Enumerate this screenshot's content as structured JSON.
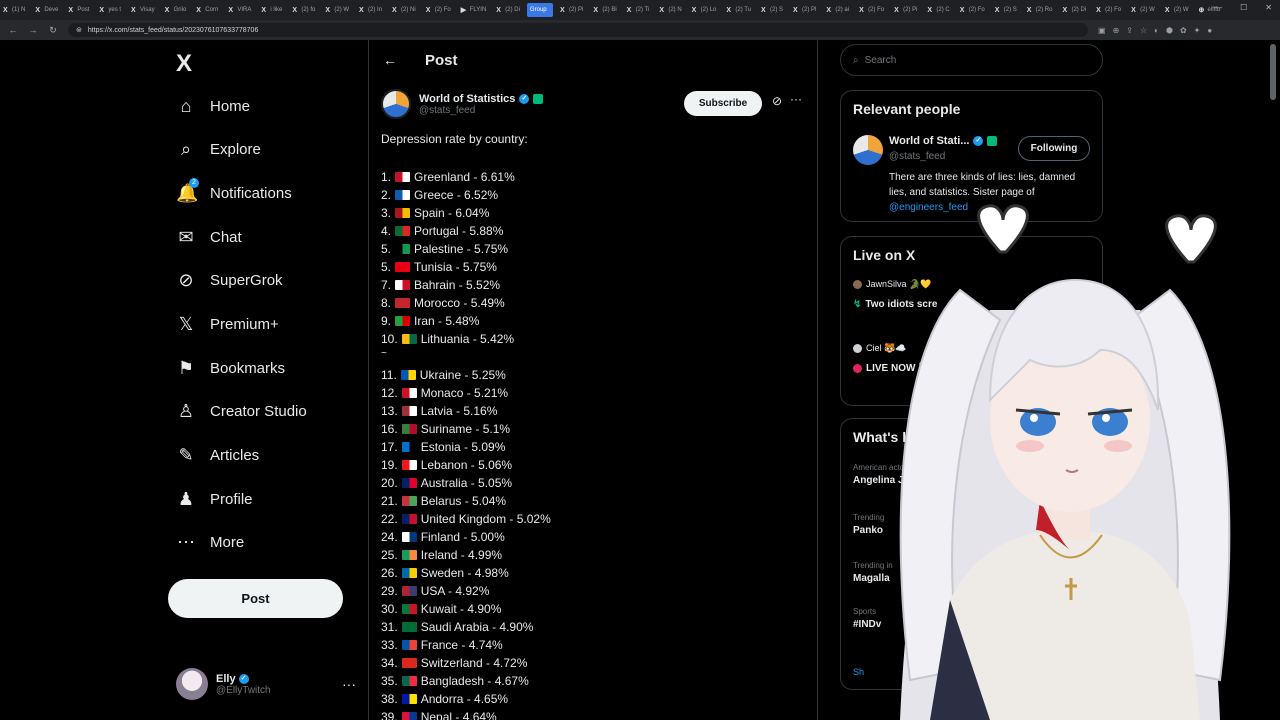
{
  "browser": {
    "tabs": [
      {
        "icon": "X",
        "label": "(1) N"
      },
      {
        "icon": "X",
        "label": "Deve"
      },
      {
        "icon": "X",
        "label": "Post"
      },
      {
        "icon": "X",
        "label": "yes t"
      },
      {
        "icon": "X",
        "label": "Visay"
      },
      {
        "icon": "X",
        "label": "Grilo"
      },
      {
        "icon": "X",
        "label": "Corn"
      },
      {
        "icon": "X",
        "label": "VIRA"
      },
      {
        "icon": "X",
        "label": "i like"
      },
      {
        "icon": "X",
        "label": "(2) fo"
      },
      {
        "icon": "X",
        "label": "(2) W"
      },
      {
        "icon": "X",
        "label": "(2) In"
      },
      {
        "icon": "X",
        "label": "(2) Ni"
      },
      {
        "icon": "X",
        "label": "(2) Fo"
      },
      {
        "icon": "▶",
        "label": "FLYIN"
      },
      {
        "icon": "X",
        "label": "(2) Di"
      },
      {
        "icon": "",
        "label": "Group",
        "active": true
      },
      {
        "icon": "X",
        "label": "(2) Pi"
      },
      {
        "icon": "X",
        "label": "(2) Bi"
      },
      {
        "icon": "X",
        "label": "(2) Ti"
      },
      {
        "icon": "X",
        "label": "(2) N"
      },
      {
        "icon": "X",
        "label": "(2) Lo"
      },
      {
        "icon": "X",
        "label": "(2) Tu"
      },
      {
        "icon": "X",
        "label": "(2) S"
      },
      {
        "icon": "X",
        "label": "(2) Pl"
      },
      {
        "icon": "X",
        "label": "(2) ai"
      },
      {
        "icon": "X",
        "label": "(2) Fo"
      },
      {
        "icon": "X",
        "label": "(2) Pi"
      },
      {
        "icon": "X",
        "label": "(2) C"
      },
      {
        "icon": "X",
        "label": "(2) Fo"
      },
      {
        "icon": "X",
        "label": "(2) S"
      },
      {
        "icon": "X",
        "label": "(2) Ro"
      },
      {
        "icon": "X",
        "label": "(2) Di"
      },
      {
        "icon": "X",
        "label": "(2) Fo"
      },
      {
        "icon": "X",
        "label": "(2) W"
      },
      {
        "icon": "X",
        "label": "(2) W"
      },
      {
        "icon": "⊕",
        "label": "elfffb"
      }
    ],
    "url": "https://x.com/stats_feed/status/2023076107633778706",
    "window_controls": [
      "—",
      "☐",
      "✕"
    ]
  },
  "leftnav": {
    "logo": "X",
    "items": [
      {
        "label": "Home",
        "icon": "home-icon",
        "glyph": "⌂"
      },
      {
        "label": "Explore",
        "icon": "search-icon",
        "glyph": "⌕"
      },
      {
        "label": "Notifications",
        "icon": "bell-icon",
        "glyph": "🔔",
        "badge": "2"
      },
      {
        "label": "Chat",
        "icon": "mail-icon",
        "glyph": "✉"
      },
      {
        "label": "SuperGrok",
        "icon": "grok-icon",
        "glyph": "⊘"
      },
      {
        "label": "Premium+",
        "icon": "x-premium-icon",
        "glyph": "𝕏"
      },
      {
        "label": "Bookmarks",
        "icon": "bookmark-icon",
        "glyph": "⚑"
      },
      {
        "label": "Creator Studio",
        "icon": "creator-studio-icon",
        "glyph": "♙"
      },
      {
        "label": "Articles",
        "icon": "articles-icon",
        "glyph": "✎"
      },
      {
        "label": "Profile",
        "icon": "profile-icon",
        "glyph": "♟"
      },
      {
        "label": "More",
        "icon": "more-circle-icon",
        "glyph": "⋯"
      }
    ],
    "post_button": "Post",
    "account": {
      "name": "Elly",
      "handle": "@EllyTwitch",
      "more": "···"
    }
  },
  "post": {
    "header_title": "Post",
    "author": {
      "name": "World of Statistics",
      "handle": "@stats_feed"
    },
    "subscribe_label": "Subscribe",
    "intro": "Depression rate by country:",
    "rows_top": [
      {
        "text": "1. ",
        "flag": [
          "#c8102e",
          "#ffffff"
        ],
        "label": "Greenland - 6.61%"
      },
      {
        "text": "2. ",
        "flag": [
          "#0d5eaf",
          "#ffffff"
        ],
        "label": "Greece - 6.52%"
      },
      {
        "text": "3. ",
        "flag": [
          "#aa151b",
          "#f1bf00"
        ],
        "label": "Spain - 6.04%"
      },
      {
        "text": "4. ",
        "flag": [
          "#046a38",
          "#da291c"
        ],
        "label": "Portugal - 5.88%"
      },
      {
        "text": "5. ",
        "flag": [
          "#000000",
          "#149954"
        ],
        "label": "Palestine - 5.75%"
      },
      {
        "text": "5. ",
        "flag": [
          "#e70013",
          "#e70013"
        ],
        "label": "Tunisia - 5.75%"
      },
      {
        "text": "7. ",
        "flag": [
          "#ffffff",
          "#ce1126"
        ],
        "label": "Bahrain - 5.52%"
      },
      {
        "text": "8. ",
        "flag": [
          "#c1272d",
          "#c1272d"
        ],
        "label": "Morocco - 5.49%"
      },
      {
        "text": "9. ",
        "flag": [
          "#239f40",
          "#da0000"
        ],
        "label": "Iran - 5.48%"
      },
      {
        "text": "10. ",
        "flag": [
          "#fdb913",
          "#006a44"
        ],
        "label": "Lithuania - 5.42%"
      }
    ],
    "separator": "~",
    "rows_bottom": [
      {
        "text": "11. ",
        "flag": [
          "#0057b7",
          "#ffd700"
        ],
        "label": "Ukraine - 5.25%"
      },
      {
        "text": "12. ",
        "flag": [
          "#ce1126",
          "#ffffff"
        ],
        "label": "Monaco - 5.21%"
      },
      {
        "text": "13. ",
        "flag": [
          "#9e3039",
          "#ffffff"
        ],
        "label": "Latvia - 5.16%"
      },
      {
        "text": "16. ",
        "flag": [
          "#377e3f",
          "#b40a2d"
        ],
        "label": "Suriname - 5.1%"
      },
      {
        "text": "17. ",
        "flag": [
          "#0072ce",
          "#000000"
        ],
        "label": "Estonia - 5.09%"
      },
      {
        "text": "19. ",
        "flag": [
          "#ee161f",
          "#ffffff"
        ],
        "label": "Lebanon - 5.06%"
      },
      {
        "text": "20. ",
        "flag": [
          "#012169",
          "#e4002b"
        ],
        "label": "Australia - 5.05%"
      },
      {
        "text": "21. ",
        "flag": [
          "#c8313e",
          "#4aa657"
        ],
        "label": "Belarus - 5.04%"
      },
      {
        "text": "22. ",
        "flag": [
          "#012169",
          "#c8102e"
        ],
        "label": "United Kingdom - 5.02%"
      },
      {
        "text": "24. ",
        "flag": [
          "#ffffff",
          "#003580"
        ],
        "label": "Finland - 5.00%"
      },
      {
        "text": "25. ",
        "flag": [
          "#169b62",
          "#ff883e"
        ],
        "label": "Ireland - 4.99%"
      },
      {
        "text": "26. ",
        "flag": [
          "#006aa7",
          "#fecc00"
        ],
        "label": "Sweden - 4.98%"
      },
      {
        "text": "29. ",
        "flag": [
          "#b22234",
          "#3c3b6e"
        ],
        "label": "USA - 4.92%"
      },
      {
        "text": "30. ",
        "flag": [
          "#007a3d",
          "#ce1126"
        ],
        "label": "Kuwait - 4.90%"
      },
      {
        "text": "31. ",
        "flag": [
          "#006c35",
          "#006c35"
        ],
        "label": "Saudi Arabia - 4.90%"
      },
      {
        "text": "33. ",
        "flag": [
          "#0055a4",
          "#ef4135"
        ],
        "label": "France - 4.74%"
      },
      {
        "text": "34. ",
        "flag": [
          "#da291c",
          "#da291c"
        ],
        "label": "Switzerland - 4.72%"
      },
      {
        "text": "35. ",
        "flag": [
          "#006a4e",
          "#f42a41"
        ],
        "label": "Bangladesh - 4.67%"
      },
      {
        "text": "38. ",
        "flag": [
          "#0018a8",
          "#fedf00"
        ],
        "label": "Andorra - 4.65%"
      },
      {
        "text": "39. ",
        "flag": [
          "#dc143c",
          "#003893"
        ],
        "label": "Nepal - 4.64%"
      }
    ]
  },
  "right": {
    "search_placeholder": "Search",
    "relevant_title": "Relevant people",
    "rp_name": "World of Stati...",
    "rp_handle": "@stats_feed",
    "following_label": "Following",
    "rp_bio": "There are three kinds of lies: lies, damned lies, and statistics. Sister page of ",
    "rp_bio_link": "@engineers_feed",
    "live_title": "Live on X",
    "live_items": [
      {
        "user": "JawnSilva 🐊💛",
        "title": "Two idiots scre"
      },
      {
        "user": "Ciel 🐯☁️",
        "title": "LIVE NOW 🐯"
      }
    ],
    "whats_title": "What's hap",
    "trends": [
      {
        "meta": "American acto",
        "name": "Angelina Jol"
      },
      {
        "meta": "Trending",
        "name": "Panko"
      },
      {
        "meta": "Trending in",
        "name": "Magalla"
      },
      {
        "meta": "Sports",
        "name": "#INDv"
      }
    ],
    "show_more": "Sh"
  },
  "colors": {
    "accent": "#1d9bf0",
    "bg": "#000000",
    "border": "#2f3336",
    "verified_org": "#00ba7c"
  }
}
